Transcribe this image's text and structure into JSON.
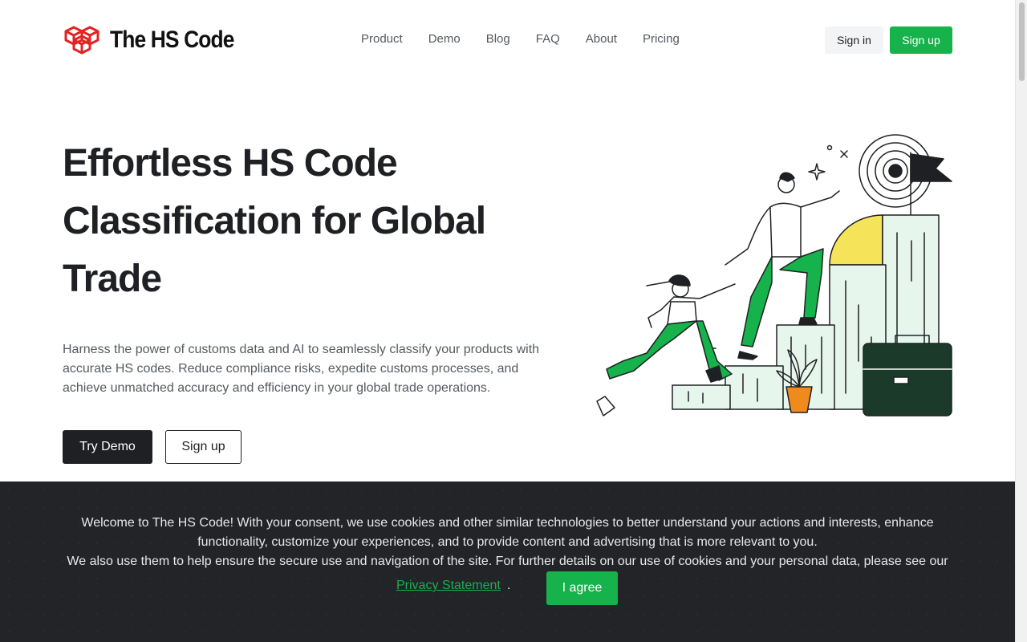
{
  "brand": {
    "name": "The HS Code",
    "accent": "#e02424",
    "green": "#16b24b"
  },
  "nav": {
    "items": [
      "Product",
      "Demo",
      "Blog",
      "FAQ",
      "About",
      "Pricing"
    ],
    "signin_label": "Sign in",
    "signup_label": "Sign up"
  },
  "hero": {
    "title": "Effortless HS Code Classification for Global Trade",
    "description": "Harness the power of customs data and AI to seamlessly classify your products with accurate HS codes. Reduce compliance risks, expedite customs processes, and achieve unmatched accuracy and efficiency in your global trade operations.",
    "try_demo_label": "Try Demo",
    "signup_label": "Sign up"
  },
  "cookie": {
    "line1": "Welcome to The HS Code! With your consent, we use cookies and other similar technologies to better understand your actions and interests, enhance functionality, customize your experiences, and to provide content and advertising that is more relevant to you.",
    "line2": "We also use them to help ensure the secure use and navigation of the site. For further details on our use of cookies and your personal data, please see our",
    "privacy_link": "Privacy Statement",
    "period": ".",
    "agree_label": "I agree"
  }
}
